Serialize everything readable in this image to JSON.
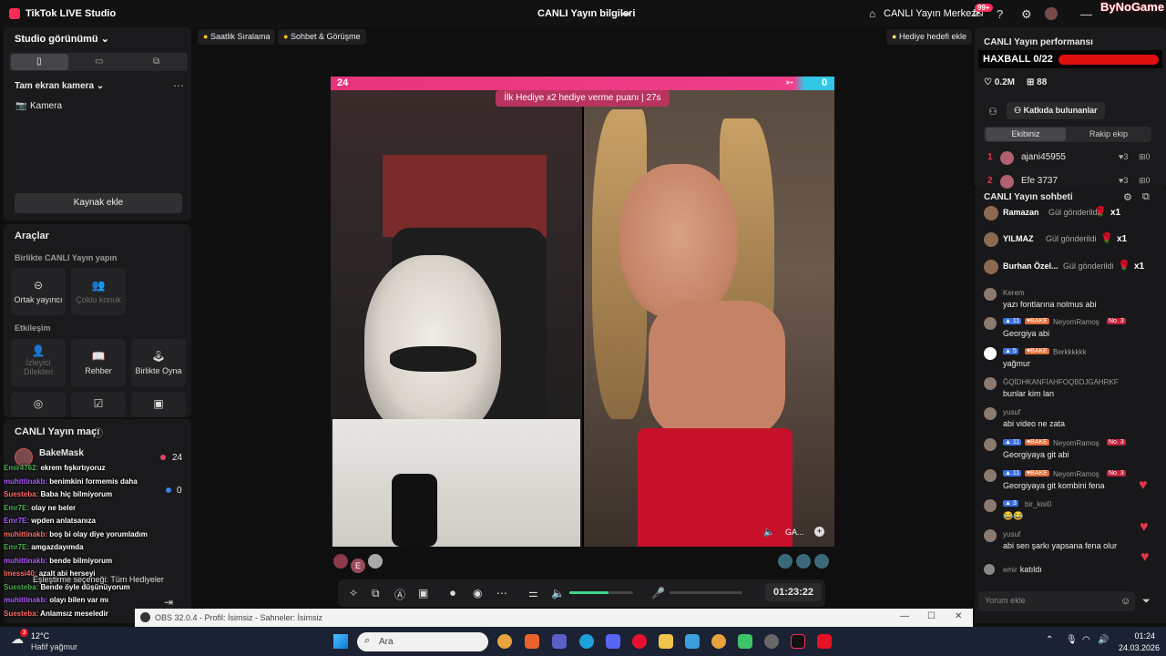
{
  "titlebar": {
    "app_title": "TikTok LIVE Studio",
    "live_info": "CANLI Yayın bilgileri",
    "live_center": "CANLI Yayın Merkezi",
    "notif_badge": "99+",
    "watermark": "ByNoGame"
  },
  "left": {
    "studio_view": "Studio görünümü",
    "fullscreen_camera": "Tam ekran kamera",
    "camera": "Kamera",
    "add_source": "Kaynak ekle",
    "tools_title": "Araçlar",
    "together_title": "Birlikte CANLI Yayın yapın",
    "co_host": "Ortak yayıncı",
    "multi_guest": "Çoklu konuk",
    "interaction_title": "Etkileşim",
    "viewer_wishes": "İzleyici Dilekleri",
    "guide": "Rehber",
    "play_together": "Birlikte Oyna",
    "match_title": "CANLI Yayın maçı",
    "host_name": "BakeMask",
    "host_score": "24",
    "opponent_score": "0",
    "pairing_option": "Eşleştirme seçeneği: Tüm Hediyeler"
  },
  "overlay_chat": [
    {
      "user": "Emir4762:",
      "text": "ekrem fışkırtıyoruz"
    },
    {
      "user": "muhittinakb:",
      "text": "benimkini formemis daha"
    },
    {
      "user": "Suesteba:",
      "text": "Baba hiç bilmiyorum"
    },
    {
      "user": "Emr7E:",
      "text": "olay ne beler"
    },
    {
      "user": "Emr7E:",
      "text": "wpden anlatsanıza"
    },
    {
      "user": "muhittinakb:",
      "text": "boş bi olay diye yorumladım"
    },
    {
      "user": "Emr7E:",
      "text": "amgazdayımda"
    },
    {
      "user": "muhittinakb:",
      "text": "bende bilmiyorum"
    },
    {
      "user": "Imessi40:",
      "text": "azalt abi herseyi"
    },
    {
      "user": "Suesteba:",
      "text": "Bende öyle düşünüyorum"
    },
    {
      "user": "muhittinakb:",
      "text": "olayı bilen var mı"
    },
    {
      "user": "Suesteba:",
      "text": "Anlamsız meseledir"
    }
  ],
  "chips": {
    "hourly_rank": "Saatlik Sıralama",
    "chat_meet": "Sohbet & Görüşme",
    "gift_goal": "Hediye hedefi ekle"
  },
  "stage": {
    "left_score": "24",
    "right_score": "0",
    "gift_banner": "İlk Hediye x2 hediye verme puanı",
    "gift_banner_timer": "27s",
    "gift_label": "GA...",
    "guest_e_label": "E",
    "timer": "01:23:22",
    "volume_level": 0.62
  },
  "performance": {
    "title": "CANLI Yayın performansı",
    "goal_label": "HAXBALL 0/22",
    "likes": "0.2M",
    "gifts": "88",
    "contributors": "Katkıda bulunanlar",
    "team_ours": "Ekibiniz",
    "team_rival": "Rakip ekip",
    "ranks": [
      {
        "rank": "1",
        "name": "ajani45955",
        "a": "3",
        "b": "0"
      },
      {
        "rank": "2",
        "name": "Efe 3737",
        "a": "3",
        "b": "0"
      }
    ]
  },
  "chat": {
    "title": "CANLI Yayın sohbeti",
    "gift_rows": [
      {
        "name": "Ramazan",
        "action": "Gül gönderildi",
        "count": "x1"
      },
      {
        "name": "YILMAZ",
        "action": "Gül gönderildi",
        "count": "x1"
      },
      {
        "name": "Burhan Özel...",
        "action": "Gül gönderildi",
        "count": "x1"
      }
    ],
    "messages": [
      {
        "name": "Kerem",
        "msg": "yazı fontlarına nolmus abi",
        "lv": "",
        "fan": "",
        "no": ""
      },
      {
        "name": "NeyomRamoş",
        "msg": "Georgiya abi",
        "lv": "11",
        "fan": "BAKE",
        "no": "No. 3"
      },
      {
        "name": "Berkkkkkk",
        "msg": "yağmur",
        "lv": "5",
        "fan": "BAKE",
        "no": ""
      },
      {
        "name": "ĞQİDHKANFİAHFOQBDJGAHRKF",
        "msg": "bunlar kim lan",
        "lv": "",
        "fan": "",
        "no": ""
      },
      {
        "name": "yusuf",
        "msg": "abi video ne zata",
        "lv": "",
        "fan": "",
        "no": ""
      },
      {
        "name": "NeyomRamoş",
        "msg": "Georgiyaya git abi",
        "lv": "11",
        "fan": "BAKE",
        "no": "No. 3"
      },
      {
        "name": "NeyomRamoş",
        "msg": "Georgiyaya git kombini fena",
        "lv": "11",
        "fan": "BAKE",
        "no": "No. 3"
      },
      {
        "name": "bir_kisi0",
        "msg": "😂😂",
        "lv": "3",
        "fan": "",
        "no": ""
      },
      {
        "name": "yusuf",
        "msg": "abi sen şarkı yapsana fena olur",
        "lv": "",
        "fan": "",
        "no": ""
      }
    ],
    "joined_user": "emir",
    "joined_text": "katıldı",
    "input_placeholder": "Yorum ekle"
  },
  "obs": {
    "text": "OBS 32.0.4 - Profil: İsimsiz - Sahneler: İsimsiz"
  },
  "taskbar": {
    "weather_badge": "3",
    "temp": "12°C",
    "weather_desc": "Hafif yağmur",
    "search_text": "Ara",
    "time": "01:24",
    "date": "24.03.2026"
  }
}
